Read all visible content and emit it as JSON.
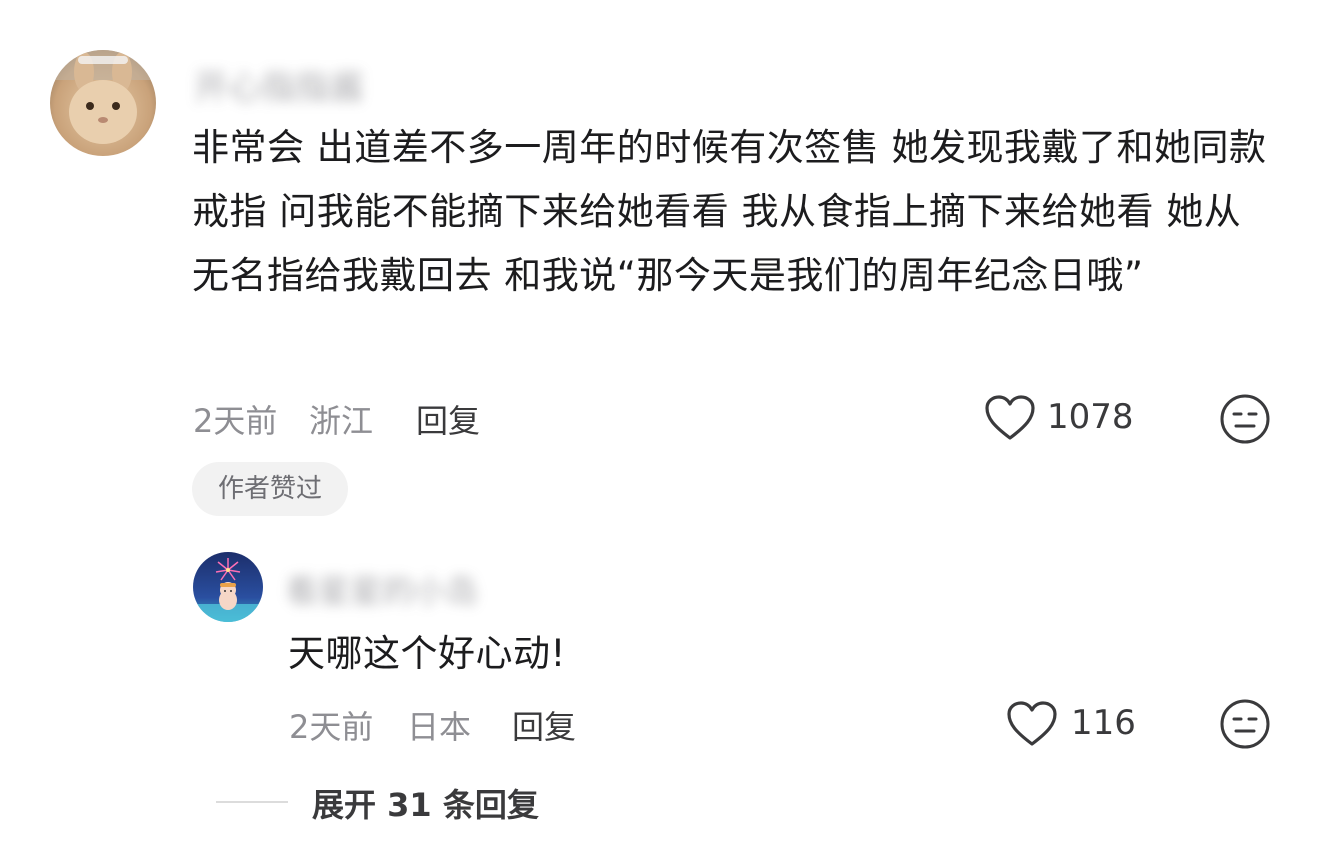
{
  "comment": {
    "username": "开心指指酱",
    "text": "非常会 出道差不多一周年的时候有次签售 她发现我戴了和她同款戒指 问我能不能摘下来给她看看 我从食指上摘下来给她看 她从无名指给我戴回去 和我说“那今天是我们的周年纪念日哦”",
    "time": "2天前",
    "location": "浙江",
    "reply_label": "回复",
    "like_count": "1078",
    "badge": "作者赞过"
  },
  "reply": {
    "username": "看星星的小岛",
    "text": "天哪这个好心动!",
    "time": "2天前",
    "location": "日本",
    "reply_label": "回复",
    "like_count": "116"
  },
  "expand": {
    "label": "展开 31 条回复"
  },
  "icons": {
    "like": "heart-outline-icon",
    "dislike": "meh-face-icon"
  },
  "colors": {
    "text_primary": "#1c1c1e",
    "text_secondary": "#8e8e93",
    "badge_bg": "#f2f2f2"
  }
}
